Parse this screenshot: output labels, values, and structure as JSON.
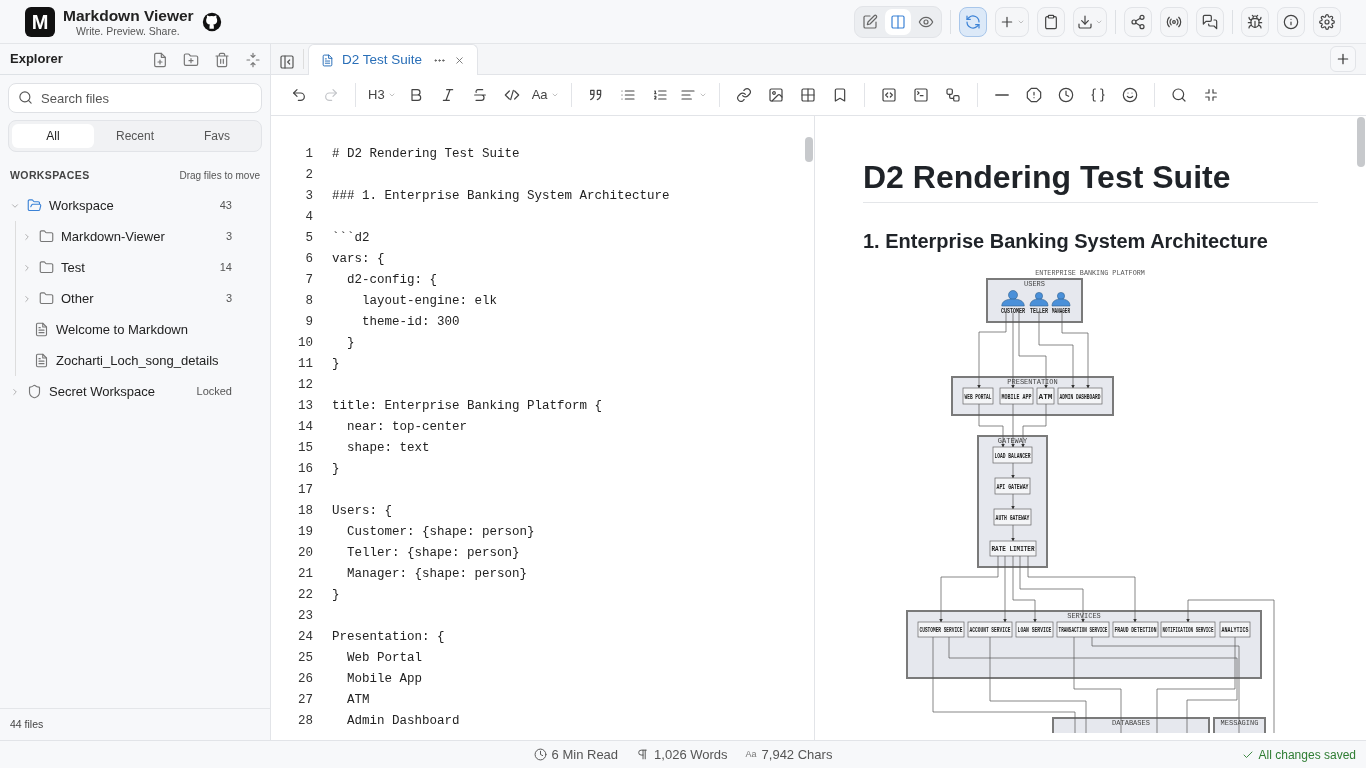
{
  "header": {
    "logo": "M",
    "title": "Markdown Viewer",
    "tagline": "Write. Preview. Share.",
    "view_modes": [
      {
        "kind": "edit",
        "selected": false
      },
      {
        "kind": "split",
        "selected": true
      },
      {
        "kind": "preview",
        "selected": false
      }
    ],
    "action_groups": [
      [
        {
          "kind": "sync",
          "active": true,
          "dropdown": false
        },
        {
          "kind": "new",
          "active": false,
          "dropdown": true
        },
        {
          "kind": "clipboard",
          "active": false,
          "dropdown": false
        },
        {
          "kind": "download",
          "active": false,
          "dropdown": true
        }
      ],
      [
        {
          "kind": "share",
          "active": false,
          "dropdown": false
        },
        {
          "kind": "broadcast",
          "active": false,
          "dropdown": false
        },
        {
          "kind": "comments",
          "active": false,
          "dropdown": false
        }
      ],
      [
        {
          "kind": "debug",
          "active": false,
          "dropdown": false
        },
        {
          "kind": "info",
          "active": false,
          "dropdown": false
        },
        {
          "kind": "settings",
          "active": false,
          "dropdown": false
        }
      ]
    ]
  },
  "sidebar": {
    "title": "Explorer",
    "search": {
      "placeholder": "Search files"
    },
    "filters": [
      {
        "label": "All",
        "selected": true
      },
      {
        "label": "Recent",
        "selected": false
      },
      {
        "label": "Favs",
        "selected": false
      }
    ],
    "section": "WORKSPACES",
    "hint": "Drag files to move",
    "tree": [
      {
        "kind": "workspace",
        "label": "Workspace",
        "count": "43",
        "expanded": true,
        "children": [
          {
            "kind": "folder",
            "label": "Markdown-Viewer",
            "count": "3",
            "expanded": false
          },
          {
            "kind": "folder",
            "label": "Test",
            "count": "14",
            "expanded": false
          },
          {
            "kind": "folder",
            "label": "Other",
            "count": "3",
            "expanded": false
          },
          {
            "kind": "file",
            "label": "Welcome to Markdown"
          },
          {
            "kind": "file",
            "label": "Zocharti_Loch_song_details"
          }
        ]
      },
      {
        "kind": "locked_workspace",
        "label": "Secret Workspace",
        "status": "Locked",
        "expanded": false
      }
    ],
    "footer": "44 files"
  },
  "tabs": [
    {
      "label": "D2 Test Suite",
      "selected": true
    }
  ],
  "toolbar": [
    [
      {
        "kind": "undo",
        "disabled": false,
        "dropdown": false
      },
      {
        "kind": "redo",
        "disabled": true,
        "dropdown": false
      }
    ],
    [
      {
        "kind": "heading",
        "label": "H3",
        "disabled": false,
        "dropdown": true
      },
      {
        "kind": "bold",
        "disabled": false,
        "dropdown": false
      },
      {
        "kind": "italic",
        "disabled": false,
        "dropdown": false
      },
      {
        "kind": "strike",
        "disabled": false,
        "dropdown": false
      },
      {
        "kind": "code",
        "disabled": false,
        "dropdown": false
      },
      {
        "kind": "font",
        "label": "Aa",
        "disabled": false,
        "dropdown": true
      }
    ],
    [
      {
        "kind": "quote",
        "disabled": false,
        "dropdown": false
      },
      {
        "kind": "bullets",
        "disabled": false,
        "dropdown": false
      },
      {
        "kind": "numbers",
        "disabled": false,
        "dropdown": false
      },
      {
        "kind": "align",
        "disabled": false,
        "dropdown": true
      }
    ],
    [
      {
        "kind": "link",
        "disabled": false,
        "dropdown": false
      },
      {
        "kind": "image",
        "disabled": false,
        "dropdown": false
      },
      {
        "kind": "table",
        "disabled": false,
        "dropdown": false
      },
      {
        "kind": "bookmark",
        "disabled": false,
        "dropdown": false
      }
    ],
    [
      {
        "kind": "codeblock",
        "disabled": false,
        "dropdown": false
      },
      {
        "kind": "terminal",
        "disabled": false,
        "dropdown": false
      },
      {
        "kind": "diagram",
        "disabled": false,
        "dropdown": false
      }
    ],
    [
      {
        "kind": "rule",
        "disabled": false,
        "dropdown": false
      },
      {
        "kind": "alert",
        "disabled": false,
        "dropdown": false
      },
      {
        "kind": "clock",
        "disabled": false,
        "dropdown": false
      },
      {
        "kind": "braces",
        "disabled": false,
        "dropdown": false
      },
      {
        "kind": "emoji",
        "disabled": false,
        "dropdown": false
      }
    ],
    [
      {
        "kind": "search",
        "disabled": false,
        "dropdown": false
      },
      {
        "kind": "collapse",
        "disabled": false,
        "dropdown": false
      }
    ]
  ],
  "editor": {
    "lines": [
      {
        "n": "1",
        "text": "# D2 Rendering Test Suite"
      },
      {
        "n": "2"
      },
      {
        "n": "3",
        "text": "### 1. Enterprise Banking System Architecture"
      },
      {
        "n": "4"
      },
      {
        "n": "5",
        "text": "```d2"
      },
      {
        "n": "6",
        "text": "vars: {"
      },
      {
        "n": "7",
        "text": "  d2-config: {"
      },
      {
        "n": "8",
        "text": "    layout-engine: elk"
      },
      {
        "n": "9",
        "text": "    theme-id: 300"
      },
      {
        "n": "10",
        "text": "  }"
      },
      {
        "n": "11",
        "text": "}"
      },
      {
        "n": "12"
      },
      {
        "n": "13",
        "text": "title: Enterprise Banking Platform {"
      },
      {
        "n": "14",
        "text": "  near: top-center"
      },
      {
        "n": "15",
        "text": "  shape: text"
      },
      {
        "n": "16",
        "text": "}"
      },
      {
        "n": "17"
      },
      {
        "n": "18",
        "text": "Users: {"
      },
      {
        "n": "19",
        "text": "  Customer: {shape: person}"
      },
      {
        "n": "20",
        "text": "  Teller: {shape: person}"
      },
      {
        "n": "21",
        "text": "  Manager: {shape: person}"
      },
      {
        "n": "22",
        "text": "}"
      },
      {
        "n": "23"
      },
      {
        "n": "24",
        "text": "Presentation: {"
      },
      {
        "n": "25",
        "text": "  Web Portal"
      },
      {
        "n": "26",
        "text": "  Mobile App"
      },
      {
        "n": "27",
        "text": "  ATM"
      },
      {
        "n": "28",
        "text": "  Admin Dashboard"
      }
    ]
  },
  "preview": {
    "h1": "D2 Rendering Test Suite",
    "h2": "1. Enterprise Banking System Architecture",
    "diagram": {
      "title": "ENTERPRISE BANKING PLATFORM",
      "groups": [
        {
          "label": "USERS",
          "members": [
            {
              "kind": "person",
              "label": "CUSTOMER"
            },
            {
              "kind": "person",
              "label": "TELLER"
            },
            {
              "kind": "person",
              "label": "MANAGER"
            }
          ]
        },
        {
          "label": "PRESENTATION",
          "members": [
            {
              "kind": "box",
              "label": "WEB PORTAL"
            },
            {
              "kind": "box",
              "label": "MOBILE APP"
            },
            {
              "kind": "box",
              "label": "ATM"
            },
            {
              "kind": "box",
              "label": "ADMIN DASHBOARD"
            }
          ]
        },
        {
          "label": "GATEWAY",
          "members": [
            {
              "kind": "box",
              "label": "LOAD BALANCER"
            },
            {
              "kind": "box",
              "label": "API GATEWAY"
            },
            {
              "kind": "box",
              "label": "AUTH GATEWAY"
            },
            {
              "kind": "box",
              "label": "RATE LIMITER"
            }
          ]
        },
        {
          "label": "SERVICES",
          "members": [
            {
              "kind": "box",
              "label": "CUSTOMER SERVICE"
            },
            {
              "kind": "box",
              "label": "ACCOUNT SERVICE"
            },
            {
              "kind": "box",
              "label": "LOAN SERVICE"
            },
            {
              "kind": "box",
              "label": "TRANSACTION SERVICE"
            },
            {
              "kind": "box",
              "label": "FRAUD DETECTION"
            },
            {
              "kind": "box",
              "label": "NOTIFICATION SERVICE"
            },
            {
              "kind": "box",
              "label": "ANALYTICS"
            }
          ]
        },
        {
          "label": "DATABASES"
        },
        {
          "label": "MESSAGING"
        }
      ]
    }
  },
  "status": {
    "items": [
      {
        "kind": "read_time",
        "text": "6 Min Read"
      },
      {
        "kind": "words",
        "text": "1,026 Words"
      },
      {
        "kind": "chars",
        "icon": "Aa",
        "text": "7,942 Chars"
      }
    ],
    "saved": "All changes saved"
  }
}
